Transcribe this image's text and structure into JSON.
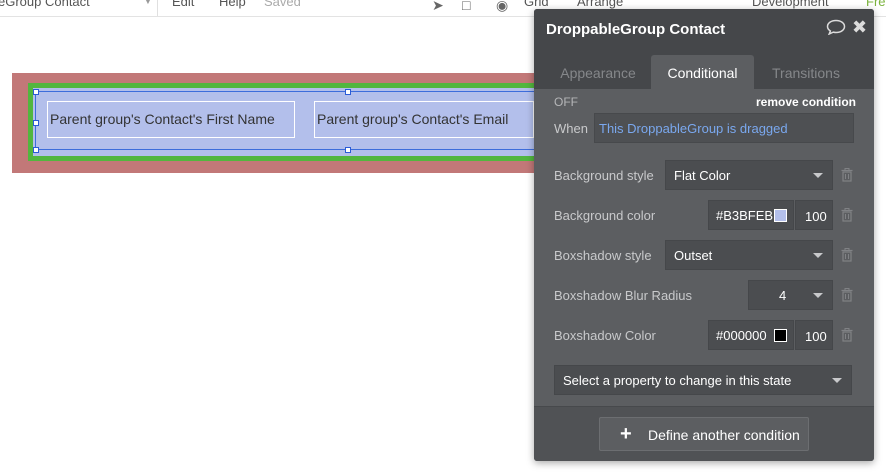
{
  "toolbar": {
    "element_name": "eGroup Contact",
    "edit": "Edit",
    "help": "Help",
    "saved": "Saved",
    "grid": "Grid",
    "arrange": "Arrange",
    "branch": "Development",
    "plan": "Fre"
  },
  "canvas": {
    "field1": "Parent group's Contact's First Name",
    "field2": "Parent group's Contact's Email",
    "colors": {
      "outer": "#c27878",
      "frame": "#52b63f",
      "fill": "#b3bfeb"
    }
  },
  "panel": {
    "title": "DroppableGroup Contact",
    "tabs": [
      "Appearance",
      "Conditional",
      "Transitions"
    ],
    "active_tab": "Conditional",
    "condition": {
      "state": "OFF",
      "remove_label": "remove condition",
      "when_label": "When",
      "when_value": "This DroppableGroup is dragged"
    },
    "properties": [
      {
        "label": "Background style",
        "value": "Flat Color"
      },
      {
        "label": "Background color",
        "hex": "#B3BFEB",
        "opacity": "100"
      },
      {
        "label": "Boxshadow style",
        "value": "Outset"
      },
      {
        "label": "Boxshadow Blur Radius",
        "value": "4"
      },
      {
        "label": "Boxshadow Color",
        "hex": "#000000",
        "opacity": "100"
      }
    ],
    "select_property": "Select a property to change in this state",
    "define_condition": "Define another condition"
  }
}
